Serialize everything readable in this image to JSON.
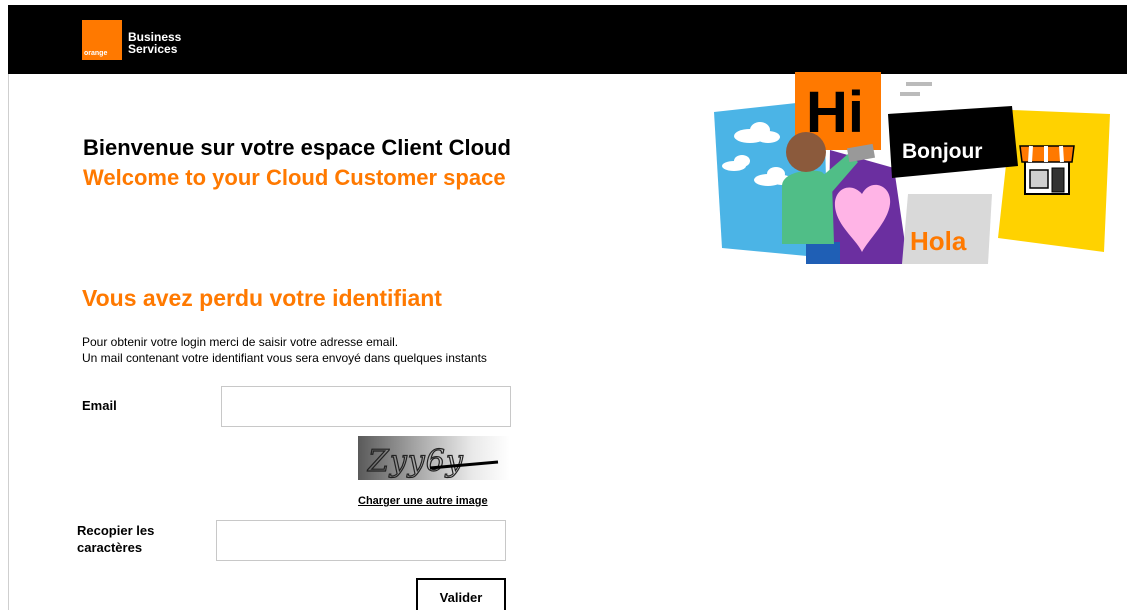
{
  "brand": {
    "logo_word": "orange",
    "name_line1": "Business",
    "name_line2": "Services",
    "accent_color": "#ff7900",
    "header_color": "#000000"
  },
  "welcome": {
    "title_fr": "Bienvenue sur votre espace Client Cloud",
    "title_en": "Welcome to your Cloud Customer space"
  },
  "illustration": {
    "word_hi": "Hi",
    "word_bonjour": "Bonjour",
    "word_hola": "Hola"
  },
  "form": {
    "title": "Vous avez perdu votre identifiant",
    "instruction_line1": "Pour obtenir votre login merci de saisir votre adresse email.",
    "instruction_line2": "Un mail contenant votre identifiant vous sera envoyé dans quelques instants",
    "email_label": "Email",
    "email_value": "",
    "captcha_text": "Zyy6y",
    "reload_captcha_label": "Charger une autre image",
    "copy_label_line1": "Recopier les",
    "copy_label_line2": "caractères",
    "copy_value": "",
    "submit_label": "Valider"
  }
}
